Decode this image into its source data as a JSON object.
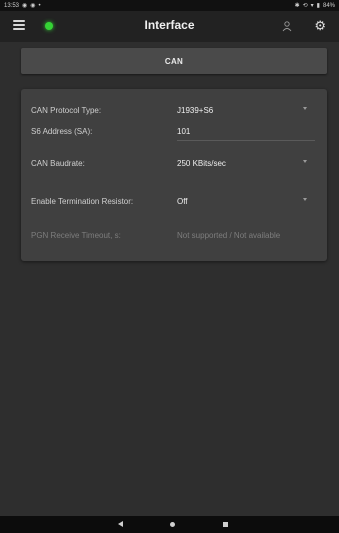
{
  "status_bar": {
    "time": "13:53",
    "battery": "84%"
  },
  "app_bar": {
    "title": "Interface",
    "connection_color": "#35d335"
  },
  "section_button": {
    "label": "CAN"
  },
  "settings": [
    {
      "label": "CAN Protocol Type:",
      "value": "J1939+S6",
      "control": "dropdown"
    },
    {
      "label": "S6 Address (SA):",
      "value": "101",
      "control": "text"
    },
    {
      "label": "CAN Baudrate:",
      "value": "250 KBits/sec",
      "control": "dropdown"
    },
    {
      "label": "Enable Termination Resistor:",
      "value": "Off",
      "control": "dropdown"
    },
    {
      "label": "PGN Receive Timeout, s:",
      "value": "Not supported / Not available",
      "control": "disabled"
    }
  ],
  "icons": {
    "menu": "menu-icon",
    "person": "person-icon",
    "settings": "gear-icon"
  }
}
